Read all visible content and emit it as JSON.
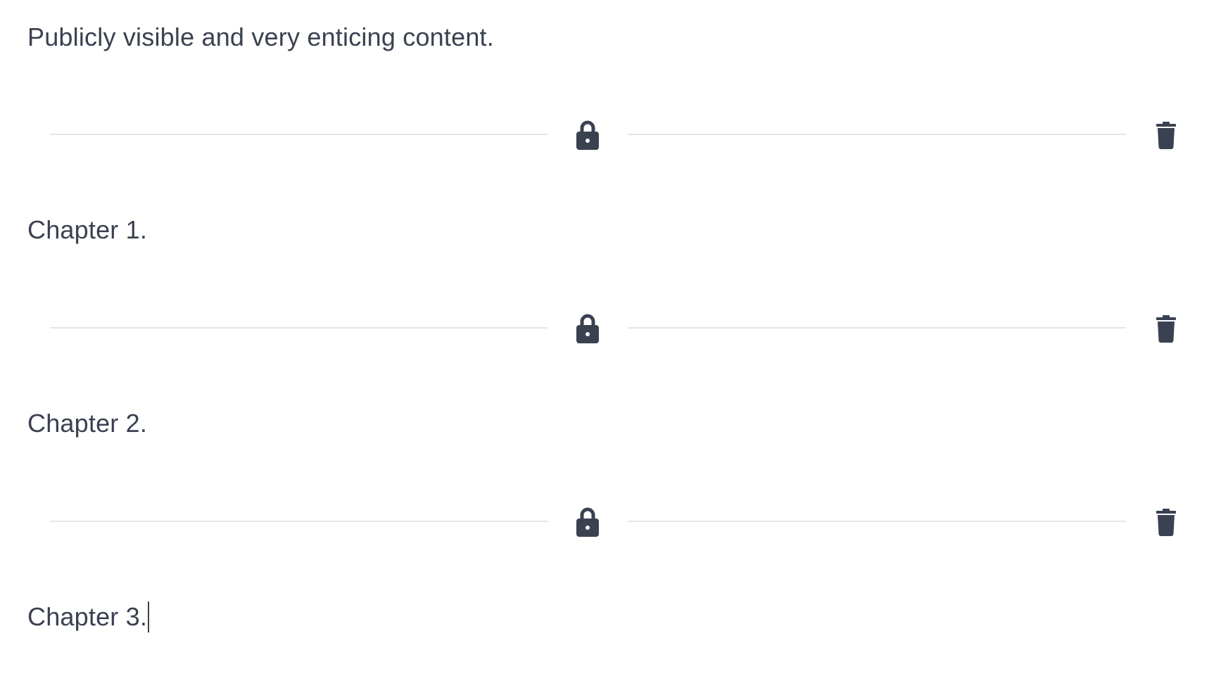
{
  "colors": {
    "text": "#3a4150",
    "divider": "#e3e5e8",
    "icon": "#3a4150"
  },
  "blocks": [
    {
      "type": "paragraph",
      "text": "Publicly visible and very enticing content."
    },
    {
      "type": "divider",
      "lock_icon": "lock-icon",
      "delete_icon": "trash-icon"
    },
    {
      "type": "paragraph",
      "text": "Chapter 1."
    },
    {
      "type": "divider",
      "lock_icon": "lock-icon",
      "delete_icon": "trash-icon"
    },
    {
      "type": "paragraph",
      "text": "Chapter 2."
    },
    {
      "type": "divider",
      "lock_icon": "lock-icon",
      "delete_icon": "trash-icon"
    },
    {
      "type": "paragraph",
      "text": "Chapter 3.",
      "has_caret": true
    }
  ]
}
